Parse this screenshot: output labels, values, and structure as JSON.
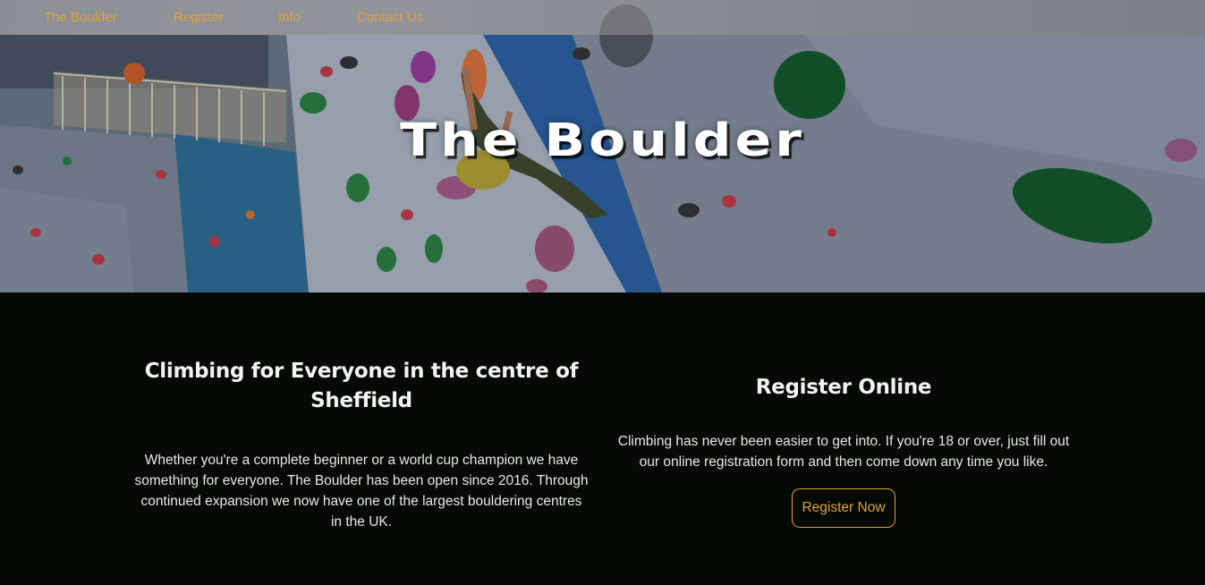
{
  "nav": {
    "items": [
      {
        "label": "The Boulder"
      },
      {
        "label": "Register"
      },
      {
        "label": "Info"
      },
      {
        "label": "Contact Us"
      }
    ]
  },
  "hero": {
    "title": "The Boulder"
  },
  "left": {
    "heading": "Climbing for Everyone in the centre of Sheffield",
    "body": "Whether you're a complete beginner or a world cup champion we have something for everyone. The Boulder has been open since 2016. Through continued expansion we now have one of the largest bouldering centres in the UK."
  },
  "right": {
    "heading": "Register Online",
    "body": "Climbing has never been easier to get into. If you're 18 or over, just fill out our online registration form and then come down any time you like.",
    "button_label": "Register Now"
  },
  "colors": {
    "accent": "#e0a23a",
    "background": "#050a05",
    "text": "#f2f2f2"
  }
}
